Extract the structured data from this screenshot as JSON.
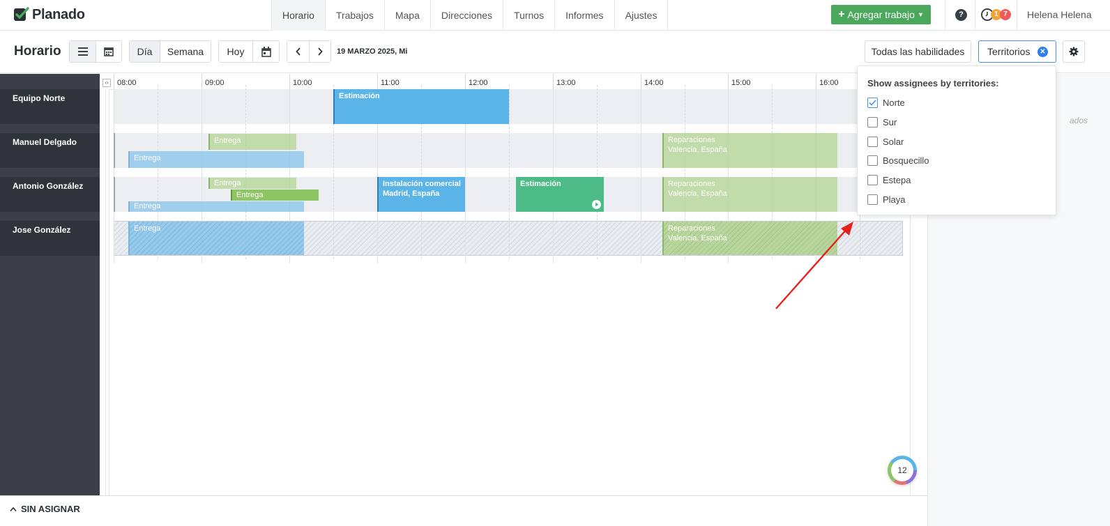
{
  "app": {
    "name": "Planado"
  },
  "nav": {
    "tabs": [
      {
        "label": "Horario"
      },
      {
        "label": "Trabajos"
      },
      {
        "label": "Mapa"
      },
      {
        "label": "Direcciones"
      },
      {
        "label": "Turnos"
      },
      {
        "label": "Informes"
      },
      {
        "label": "Ajustes"
      }
    ]
  },
  "header": {
    "add_job": "Agregar trabajo",
    "help": "?",
    "badge_orange": "1",
    "badge_red": "7",
    "user": "Helena Helena"
  },
  "toolbar": {
    "title": "Horario",
    "view_day": "Día",
    "view_week": "Semana",
    "today": "Hoy",
    "date": "19 MARZO 2025, Mi",
    "skills": "Todas las habilidades",
    "territories": "Territorios"
  },
  "timeline": {
    "hours": [
      "08:00",
      "09:00",
      "10:00",
      "11:00",
      "12:00",
      "13:00",
      "14:00",
      "15:00",
      "16:00"
    ]
  },
  "rows": [
    {
      "name": "Equipo Norte"
    },
    {
      "name": "Manuel Delgado"
    },
    {
      "name": "Antonio González"
    },
    {
      "name": "Jose González"
    }
  ],
  "jobs": {
    "estimacion_1": "Estimación",
    "entrega": "Entrega",
    "reparaciones": "Reparaciones",
    "valencia": "Valencia, España",
    "instalacion": "Instalación comercial",
    "madrid": "Madrid, España",
    "estimacion_2": "Estimación"
  },
  "territory_filter": {
    "title": "Show assignees by territories:",
    "options": [
      {
        "label": "Norte",
        "checked": true
      },
      {
        "label": "Sur",
        "checked": false
      },
      {
        "label": "Solar",
        "checked": false
      },
      {
        "label": "Bosquecillo",
        "checked": false
      },
      {
        "label": "Estepa",
        "checked": false
      },
      {
        "label": "Playa",
        "checked": false
      }
    ]
  },
  "right_panel": {
    "partial_text": "ados"
  },
  "bottom": {
    "unassigned": "SIN ASIGNAR",
    "counter": "12"
  },
  "colors": {
    "accent": "#4aa85c",
    "job_blue": "#5bb4e8",
    "job_green": "#8ec665",
    "job_teal": "#4dbb85",
    "sidebar": "#3a3f48",
    "annotation_arrow": "#e8201c"
  }
}
